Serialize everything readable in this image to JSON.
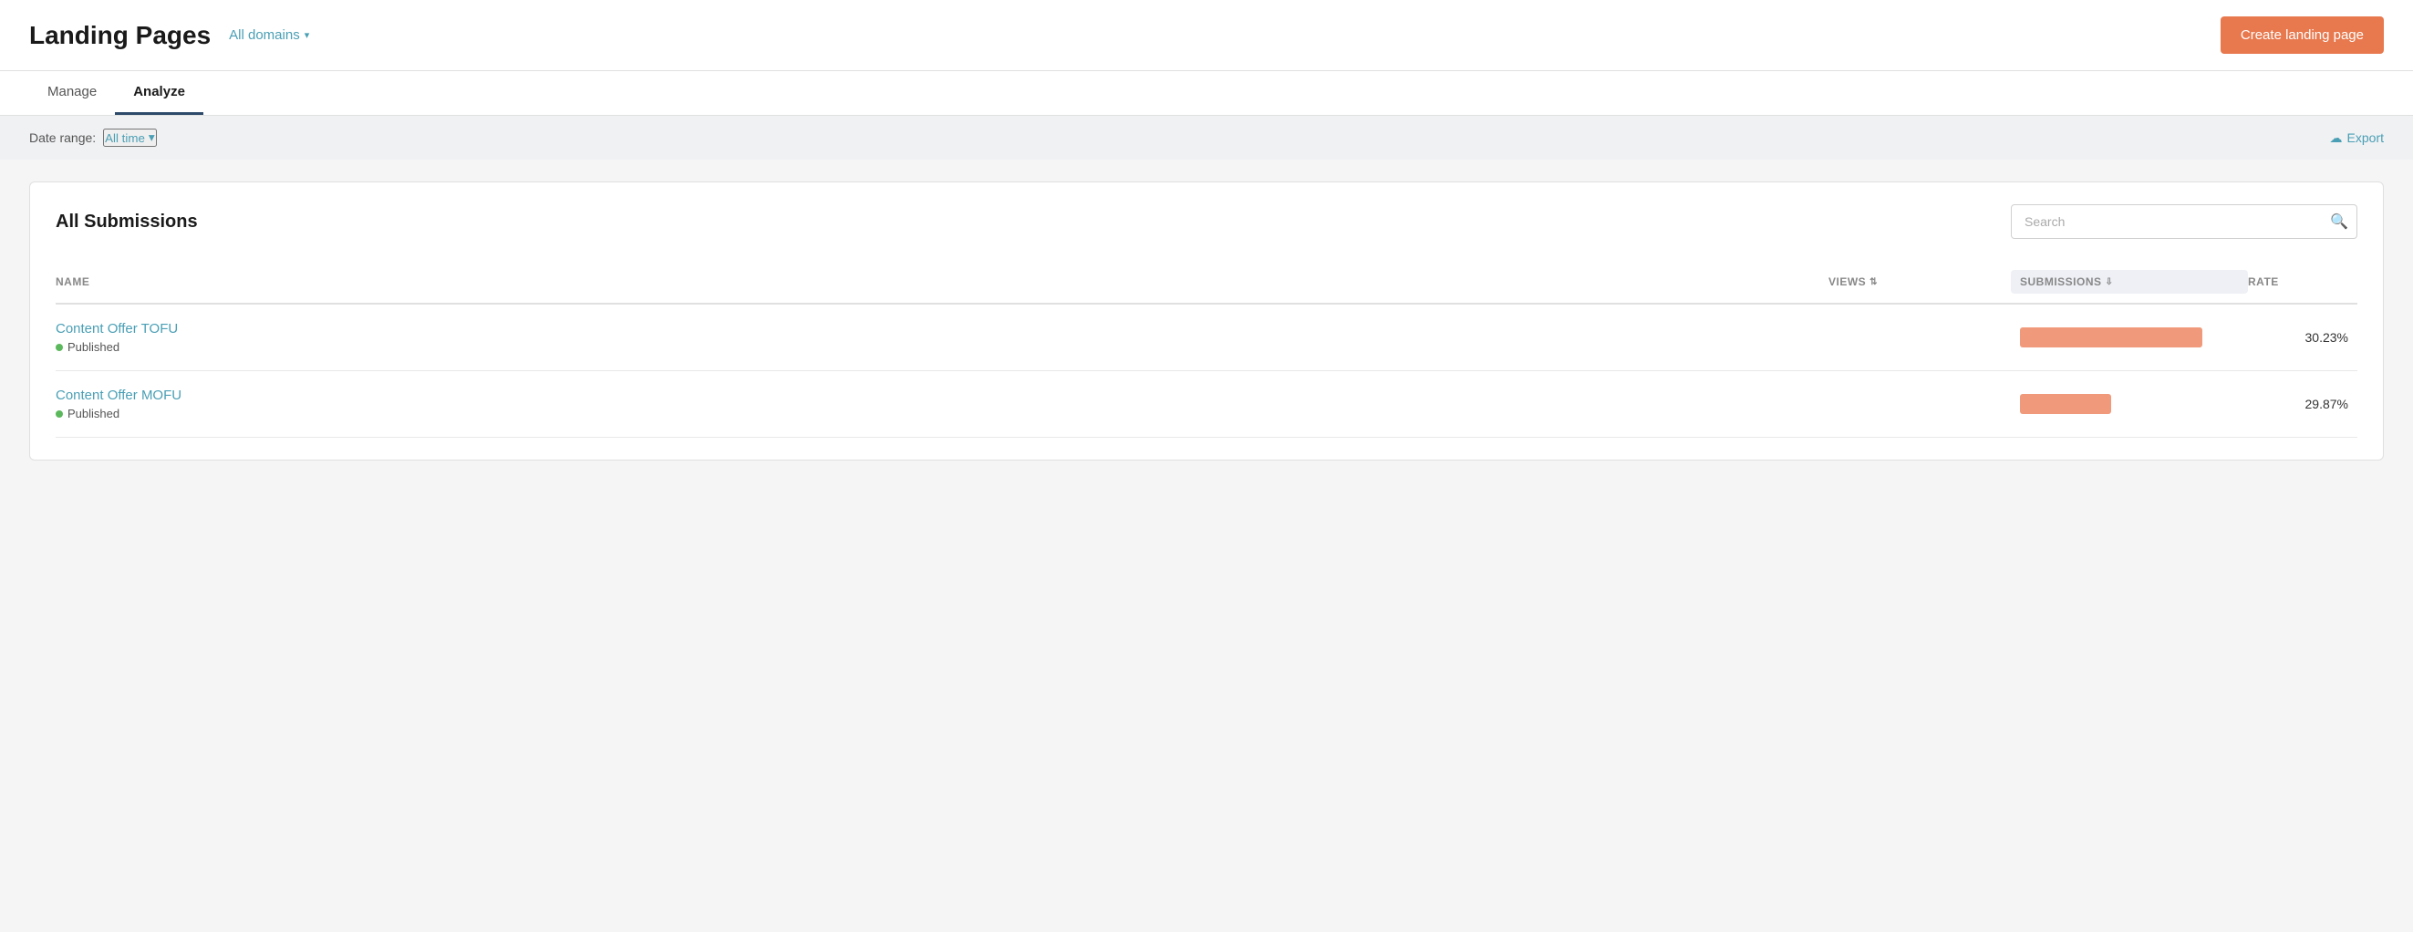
{
  "header": {
    "page_title": "Landing Pages",
    "domain_dropdown_label": "All domains",
    "create_button_label": "Create landing page"
  },
  "tabs": [
    {
      "id": "manage",
      "label": "Manage",
      "active": false
    },
    {
      "id": "analyze",
      "label": "Analyze",
      "active": true
    }
  ],
  "filters": {
    "date_range_label": "Date range:",
    "date_range_value": "All time",
    "export_label": "Export"
  },
  "submissions_section": {
    "title": "All Submissions",
    "search_placeholder": "Search",
    "columns": [
      {
        "id": "name",
        "label": "NAME",
        "sortable": false,
        "active": false
      },
      {
        "id": "views",
        "label": "VIEWS",
        "sortable": true,
        "active": false
      },
      {
        "id": "submissions",
        "label": "SUBMISSIONS",
        "sortable": true,
        "active": true
      },
      {
        "id": "rate",
        "label": "RATE",
        "sortable": false,
        "active": false
      }
    ],
    "rows": [
      {
        "id": 1,
        "name": "Content Offer TOFU",
        "status": "Published",
        "views": "",
        "submissions_bar_width": 200,
        "rate": "30.23%"
      },
      {
        "id": 2,
        "name": "Content Offer MOFU",
        "status": "Published",
        "views": "",
        "submissions_bar_width": 100,
        "rate": "29.87%"
      }
    ]
  },
  "colors": {
    "teal": "#4a9fb5",
    "orange_btn": "#e8784d",
    "bar_color": "#f09a7b",
    "active_tab_underline": "#2d4a6a",
    "published_dot": "#5cb85c"
  }
}
